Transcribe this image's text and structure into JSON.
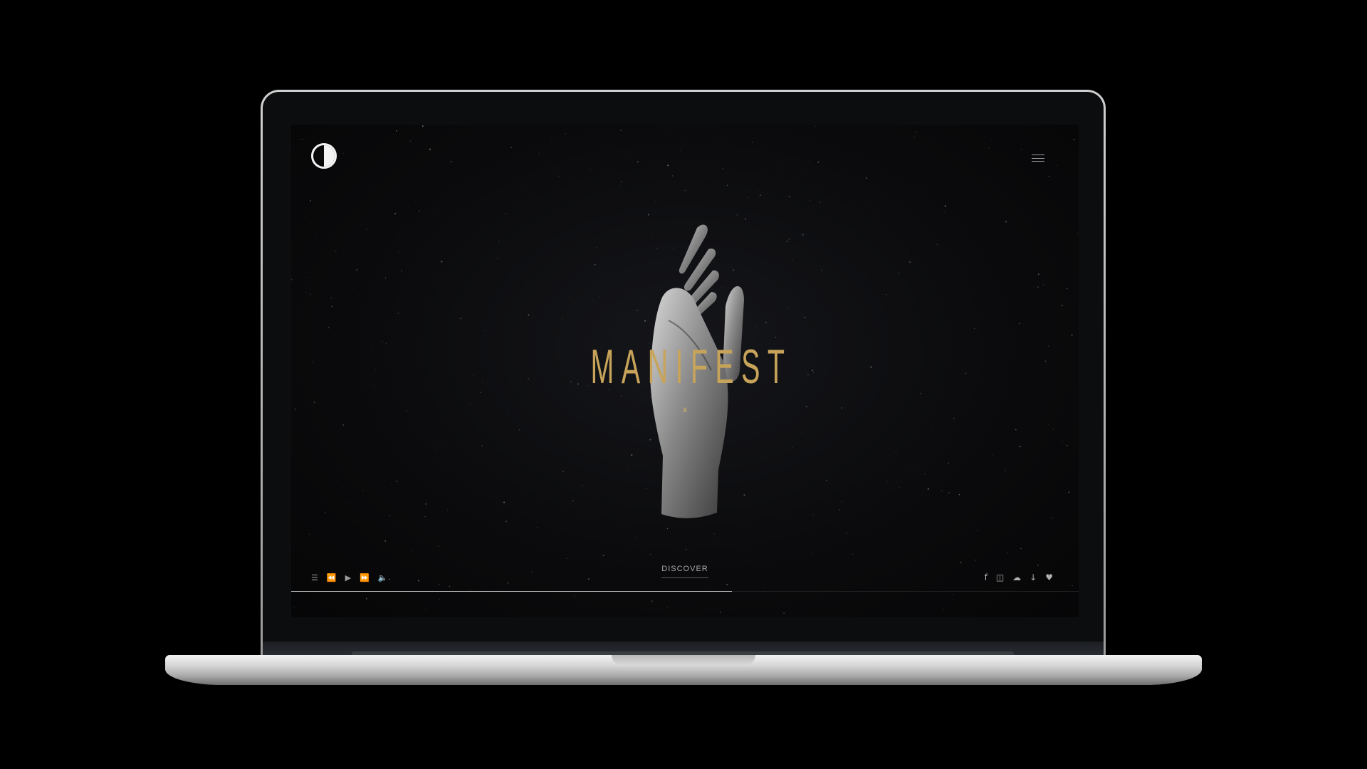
{
  "site": {
    "title": "MANIFEST",
    "close_symbol": "x",
    "discover_label": "DISCOVER",
    "logo_icon": "half-moon-logo",
    "menu_icon": "hamburger-menu-icon"
  },
  "player_controls": [
    {
      "name": "playlist-icon",
      "glyph": "☰"
    },
    {
      "name": "rewind-icon",
      "glyph": "⏪"
    },
    {
      "name": "play-icon",
      "glyph": "▶"
    },
    {
      "name": "fast-forward-icon",
      "glyph": "⏩"
    },
    {
      "name": "volume-icon",
      "glyph": "🔈"
    }
  ],
  "social_links": [
    {
      "name": "facebook-icon",
      "glyph": "f"
    },
    {
      "name": "instagram-icon",
      "glyph": "◫"
    },
    {
      "name": "soundcloud-icon",
      "glyph": "☁"
    },
    {
      "name": "download-icon",
      "glyph": "↓"
    },
    {
      "name": "heart-icon",
      "glyph": "♥"
    }
  ],
  "progress": {
    "fraction": 0.56
  },
  "colors": {
    "accent": "#c7a45a",
    "background": "#0b0b0d"
  }
}
